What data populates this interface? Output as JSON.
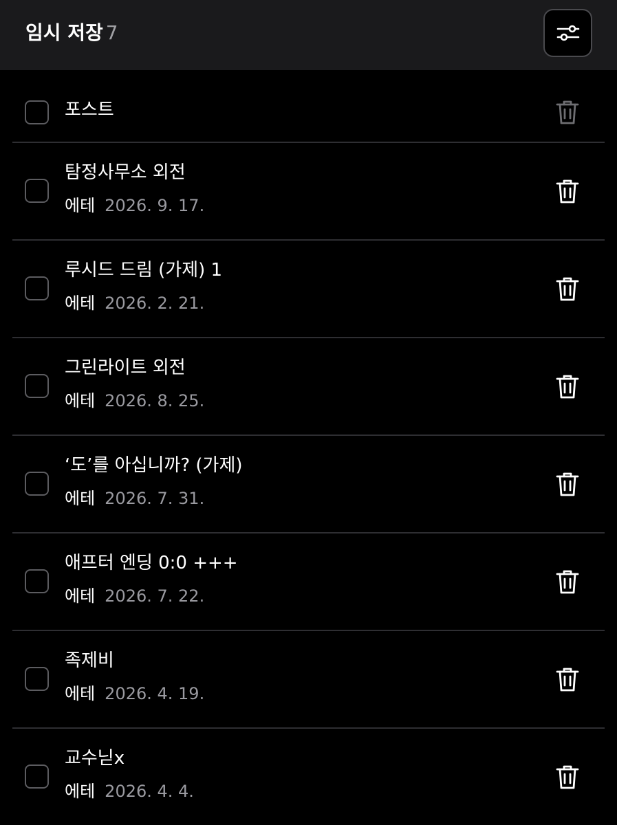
{
  "header": {
    "title": "임시 저장",
    "count": "7",
    "filter_icon": "sliders-icon"
  },
  "post_row": {
    "title": "포스트",
    "trash_color": "#6e6e72"
  },
  "drafts": [
    {
      "title": "탐정사무소 외전",
      "author": "에테",
      "date": "2026. 9. 17."
    },
    {
      "title": "루시드 드림 (가제) 1",
      "author": "에테",
      "date": "2026. 2. 21."
    },
    {
      "title": "그린라이트 외전",
      "author": "에테",
      "date": "2026. 8. 25."
    },
    {
      "title": "‘도’를 아십니까? (가제)",
      "author": "에테",
      "date": "2026. 7. 31."
    },
    {
      "title": "애프터 엔딩 0:0 +++",
      "author": "에테",
      "date": "2026. 7. 22."
    },
    {
      "title": "족제비",
      "author": "에테",
      "date": "2026. 4. 19."
    },
    {
      "title": "교수닏x",
      "author": "에테",
      "date": "2026. 4. 4."
    }
  ],
  "colors": {
    "background": "#000000",
    "header_bg": "#1a1a1c",
    "divider": "#2e2e32",
    "muted_text": "#9a9aa0",
    "icon": "#ffffff"
  }
}
